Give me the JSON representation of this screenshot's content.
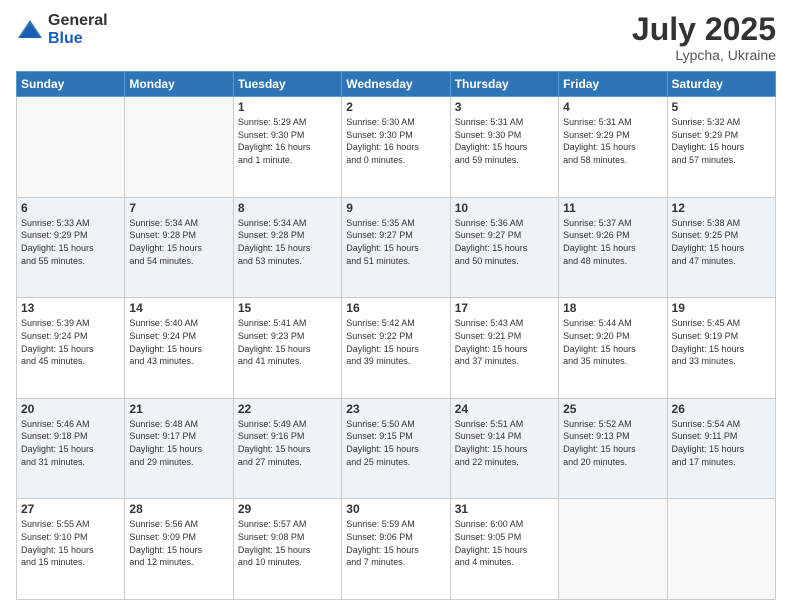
{
  "header": {
    "logo_general": "General",
    "logo_blue": "Blue",
    "month": "July 2025",
    "location": "Lypcha, Ukraine"
  },
  "days_of_week": [
    "Sunday",
    "Monday",
    "Tuesday",
    "Wednesday",
    "Thursday",
    "Friday",
    "Saturday"
  ],
  "weeks": [
    [
      {
        "day": "",
        "content": ""
      },
      {
        "day": "",
        "content": ""
      },
      {
        "day": "1",
        "content": "Sunrise: 5:29 AM\nSunset: 9:30 PM\nDaylight: 16 hours\nand 1 minute."
      },
      {
        "day": "2",
        "content": "Sunrise: 5:30 AM\nSunset: 9:30 PM\nDaylight: 16 hours\nand 0 minutes."
      },
      {
        "day": "3",
        "content": "Sunrise: 5:31 AM\nSunset: 9:30 PM\nDaylight: 15 hours\nand 59 minutes."
      },
      {
        "day": "4",
        "content": "Sunrise: 5:31 AM\nSunset: 9:29 PM\nDaylight: 15 hours\nand 58 minutes."
      },
      {
        "day": "5",
        "content": "Sunrise: 5:32 AM\nSunset: 9:29 PM\nDaylight: 15 hours\nand 57 minutes."
      }
    ],
    [
      {
        "day": "6",
        "content": "Sunrise: 5:33 AM\nSunset: 9:29 PM\nDaylight: 15 hours\nand 55 minutes."
      },
      {
        "day": "7",
        "content": "Sunrise: 5:34 AM\nSunset: 9:28 PM\nDaylight: 15 hours\nand 54 minutes."
      },
      {
        "day": "8",
        "content": "Sunrise: 5:34 AM\nSunset: 9:28 PM\nDaylight: 15 hours\nand 53 minutes."
      },
      {
        "day": "9",
        "content": "Sunrise: 5:35 AM\nSunset: 9:27 PM\nDaylight: 15 hours\nand 51 minutes."
      },
      {
        "day": "10",
        "content": "Sunrise: 5:36 AM\nSunset: 9:27 PM\nDaylight: 15 hours\nand 50 minutes."
      },
      {
        "day": "11",
        "content": "Sunrise: 5:37 AM\nSunset: 9:26 PM\nDaylight: 15 hours\nand 48 minutes."
      },
      {
        "day": "12",
        "content": "Sunrise: 5:38 AM\nSunset: 9:25 PM\nDaylight: 15 hours\nand 47 minutes."
      }
    ],
    [
      {
        "day": "13",
        "content": "Sunrise: 5:39 AM\nSunset: 9:24 PM\nDaylight: 15 hours\nand 45 minutes."
      },
      {
        "day": "14",
        "content": "Sunrise: 5:40 AM\nSunset: 9:24 PM\nDaylight: 15 hours\nand 43 minutes."
      },
      {
        "day": "15",
        "content": "Sunrise: 5:41 AM\nSunset: 9:23 PM\nDaylight: 15 hours\nand 41 minutes."
      },
      {
        "day": "16",
        "content": "Sunrise: 5:42 AM\nSunset: 9:22 PM\nDaylight: 15 hours\nand 39 minutes."
      },
      {
        "day": "17",
        "content": "Sunrise: 5:43 AM\nSunset: 9:21 PM\nDaylight: 15 hours\nand 37 minutes."
      },
      {
        "day": "18",
        "content": "Sunrise: 5:44 AM\nSunset: 9:20 PM\nDaylight: 15 hours\nand 35 minutes."
      },
      {
        "day": "19",
        "content": "Sunrise: 5:45 AM\nSunset: 9:19 PM\nDaylight: 15 hours\nand 33 minutes."
      }
    ],
    [
      {
        "day": "20",
        "content": "Sunrise: 5:46 AM\nSunset: 9:18 PM\nDaylight: 15 hours\nand 31 minutes."
      },
      {
        "day": "21",
        "content": "Sunrise: 5:48 AM\nSunset: 9:17 PM\nDaylight: 15 hours\nand 29 minutes."
      },
      {
        "day": "22",
        "content": "Sunrise: 5:49 AM\nSunset: 9:16 PM\nDaylight: 15 hours\nand 27 minutes."
      },
      {
        "day": "23",
        "content": "Sunrise: 5:50 AM\nSunset: 9:15 PM\nDaylight: 15 hours\nand 25 minutes."
      },
      {
        "day": "24",
        "content": "Sunrise: 5:51 AM\nSunset: 9:14 PM\nDaylight: 15 hours\nand 22 minutes."
      },
      {
        "day": "25",
        "content": "Sunrise: 5:52 AM\nSunset: 9:13 PM\nDaylight: 15 hours\nand 20 minutes."
      },
      {
        "day": "26",
        "content": "Sunrise: 5:54 AM\nSunset: 9:11 PM\nDaylight: 15 hours\nand 17 minutes."
      }
    ],
    [
      {
        "day": "27",
        "content": "Sunrise: 5:55 AM\nSunset: 9:10 PM\nDaylight: 15 hours\nand 15 minutes."
      },
      {
        "day": "28",
        "content": "Sunrise: 5:56 AM\nSunset: 9:09 PM\nDaylight: 15 hours\nand 12 minutes."
      },
      {
        "day": "29",
        "content": "Sunrise: 5:57 AM\nSunset: 9:08 PM\nDaylight: 15 hours\nand 10 minutes."
      },
      {
        "day": "30",
        "content": "Sunrise: 5:59 AM\nSunset: 9:06 PM\nDaylight: 15 hours\nand 7 minutes."
      },
      {
        "day": "31",
        "content": "Sunrise: 6:00 AM\nSunset: 9:05 PM\nDaylight: 15 hours\nand 4 minutes."
      },
      {
        "day": "",
        "content": ""
      },
      {
        "day": "",
        "content": ""
      }
    ]
  ]
}
